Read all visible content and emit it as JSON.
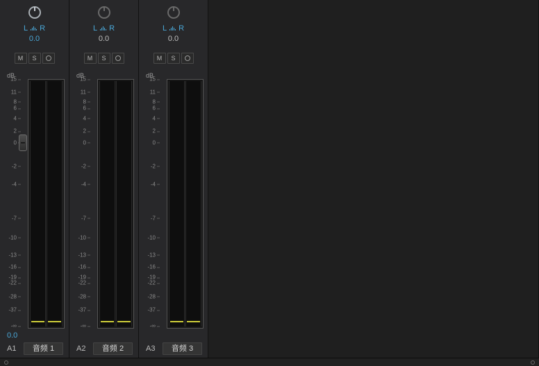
{
  "pan": {
    "left": "L",
    "right": "R",
    "value": "0.0"
  },
  "buttons": {
    "mute": "M",
    "solo": "S"
  },
  "db_label": "dB",
  "scale": [
    {
      "label": "15",
      "pct": 0
    },
    {
      "label": "11",
      "pct": 5.2
    },
    {
      "label": "8",
      "pct": 9.1
    },
    {
      "label": "6",
      "pct": 11.8
    },
    {
      "label": "4",
      "pct": 15.8
    },
    {
      "label": "2",
      "pct": 20.9
    },
    {
      "label": "0",
      "pct": 25.5
    },
    {
      "label": "-2",
      "pct": 34.9
    },
    {
      "label": "-4",
      "pct": 42.2
    },
    {
      "label": "-7",
      "pct": 55.8
    },
    {
      "label": "-10",
      "pct": 63.5
    },
    {
      "label": "-13",
      "pct": 70.5
    },
    {
      "label": "-16",
      "pct": 75.4
    },
    {
      "label": "-19",
      "pct": 79.5
    },
    {
      "label": "-22",
      "pct": 81.8
    },
    {
      "label": "-28",
      "pct": 87.2
    },
    {
      "label": "-37",
      "pct": 92.6
    },
    {
      "label": "-∞",
      "pct": 99.0
    }
  ],
  "tracks": [
    {
      "id": "A1",
      "name": "音频 1",
      "active": true,
      "level": "0.0"
    },
    {
      "id": "A2",
      "name": "音频 2",
      "active": false,
      "level": ""
    },
    {
      "id": "A3",
      "name": "音频 3",
      "active": false,
      "level": ""
    }
  ]
}
